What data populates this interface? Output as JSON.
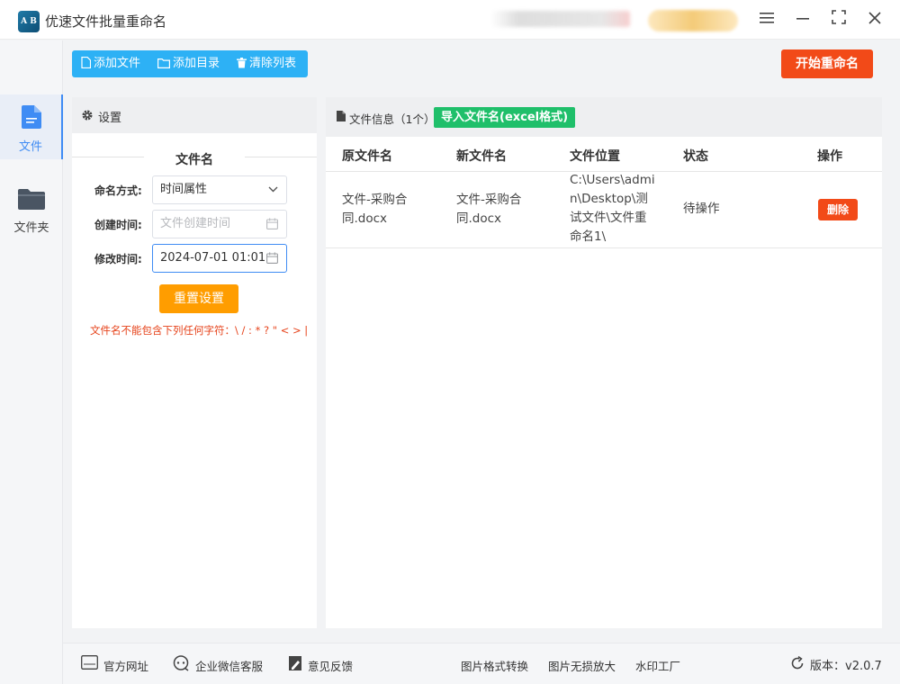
{
  "app": {
    "title": "优速文件批量重命名",
    "logo_text": "A B"
  },
  "window": {
    "menu_icon": "hamburger-icon",
    "min_icon": "minimize-icon",
    "max_icon": "maximize-icon",
    "close_icon": "close-icon"
  },
  "nav": {
    "file_label": "文件",
    "folder_label": "文件夹"
  },
  "toolbar": {
    "add_file": "添加文件",
    "add_dir": "添加目录",
    "clear_list": "清除列表",
    "start": "开始重命名"
  },
  "settings": {
    "header": "设置",
    "section_title": "文件名",
    "naming_mode_label": "命名方式:",
    "naming_mode_value": "时间属性",
    "create_time_label": "创建时间:",
    "create_time_placeholder": "文件创建时间",
    "modify_time_label": "修改时间:",
    "modify_time_value": "2024-07-01 01:01",
    "reset": "重置设置",
    "warning": "文件名不能包含下列任何字符：\\ / : * ? \" < > |"
  },
  "file_panel": {
    "header": "文件信息（1个）",
    "import_btn": "导入文件名(excel格式)",
    "columns": [
      "原文件名",
      "新文件名",
      "文件位置",
      "状态",
      "操作"
    ],
    "rows": [
      {
        "original": "文件-采购合同.docx",
        "original_lines": [
          "文件-采购合",
          "同.docx"
        ],
        "new": "文件-采购合同.docx",
        "new_lines": [
          "文件-采购合",
          "同.docx"
        ],
        "location": "C:\\Users\\admin\\Desktop\\测试文件\\文件重命名1\\",
        "location_lines": [
          "C:\\Users\\admi",
          "n\\Desktop\\测",
          "试文件\\文件重",
          "命名1\\"
        ],
        "status": "待操作",
        "action": "删除"
      }
    ]
  },
  "footer": {
    "website": "官方网址",
    "wechat": "企业微信客服",
    "feedback": "意见反馈",
    "img_convert": "图片格式转换",
    "img_enlarge": "图片无损放大",
    "watermark": "水印工厂",
    "version": "版本：v2.0.7"
  },
  "colors": {
    "accent_blue": "#2db1f5",
    "start_red": "#f24a18",
    "reset_orange": "#ff9d00",
    "import_green": "#1fbf6a",
    "nav_active": "#3f8cf4"
  }
}
